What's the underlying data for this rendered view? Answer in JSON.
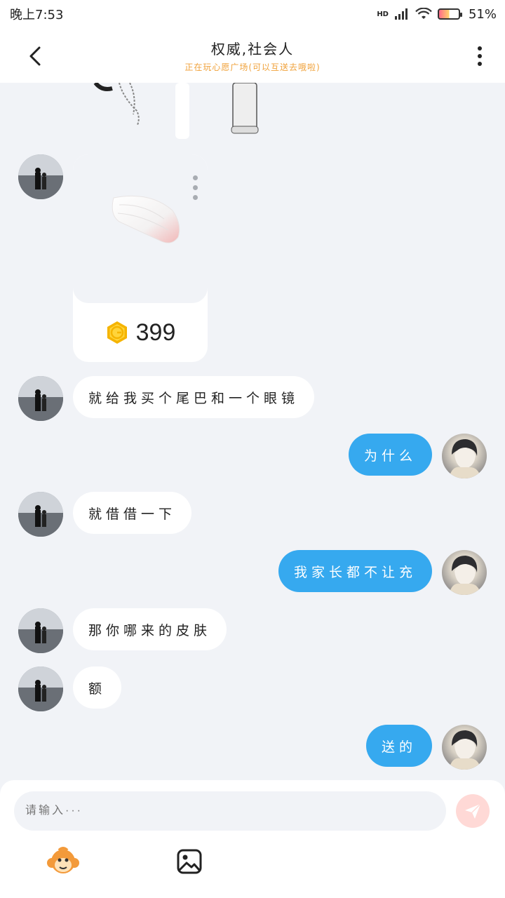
{
  "status_bar": {
    "time": "晚上7:53",
    "network": "HD",
    "battery": "51%",
    "battery_level": 0.51
  },
  "header": {
    "title": "权威,社会人",
    "subtitle": "正在玩心愿广场(可以互送去哦啦)"
  },
  "gift": {
    "price": "399"
  },
  "messages": [
    {
      "side": "left",
      "text": "就给我买个尾巴和一个眼镜"
    },
    {
      "side": "right",
      "text": "为什么"
    },
    {
      "side": "left",
      "text": "就借借一下"
    },
    {
      "side": "right",
      "text": "我家长都不让充"
    },
    {
      "side": "left",
      "text": "那你哪来的皮肤"
    },
    {
      "side": "left",
      "text": "额"
    },
    {
      "side": "right",
      "text": "送的"
    }
  ],
  "input": {
    "placeholder": "请输入···"
  },
  "icons": {
    "back": "back-arrow-icon",
    "more": "more-vertical-icon",
    "send": "send-icon",
    "emoji": "monkey-emoji-icon",
    "image": "image-icon",
    "coin": "coin-icon"
  },
  "colors": {
    "bubble_self": "#36a9ef",
    "bubble_other": "#ffffff",
    "subtitle": "#f0a23b",
    "background": "#f1f3f7"
  }
}
